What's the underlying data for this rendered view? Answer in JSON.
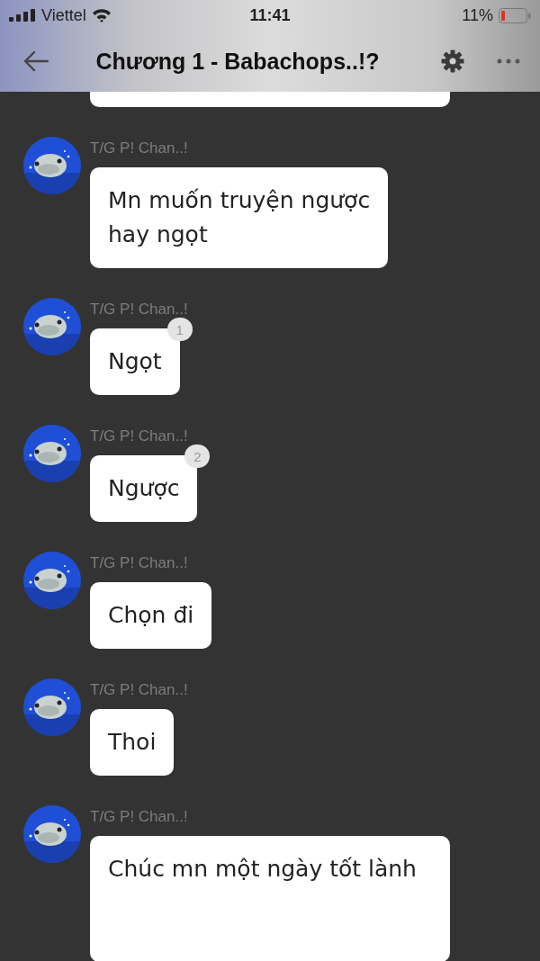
{
  "status_bar": {
    "carrier": "Viettel",
    "time": "11:41",
    "battery": "11%"
  },
  "header": {
    "title": "Chương 1 - Babachops..!?"
  },
  "messages": [
    {
      "author": "T/G P! Chan..!",
      "text": "Mn muốn truyện ngược\nhay ngọt"
    },
    {
      "author": "T/G P! Chan..!",
      "text": "Ngọt",
      "count": "1"
    },
    {
      "author": "T/G P! Chan..!",
      "text": "Ngược",
      "count": "2"
    },
    {
      "author": "T/G P! Chan..!",
      "text": "Chọn đi"
    },
    {
      "author": "T/G P! Chan..!",
      "text": "Thoi"
    },
    {
      "author": "T/G P! Chan..!",
      "text": "Chúc mn một ngày tốt lành"
    }
  ]
}
